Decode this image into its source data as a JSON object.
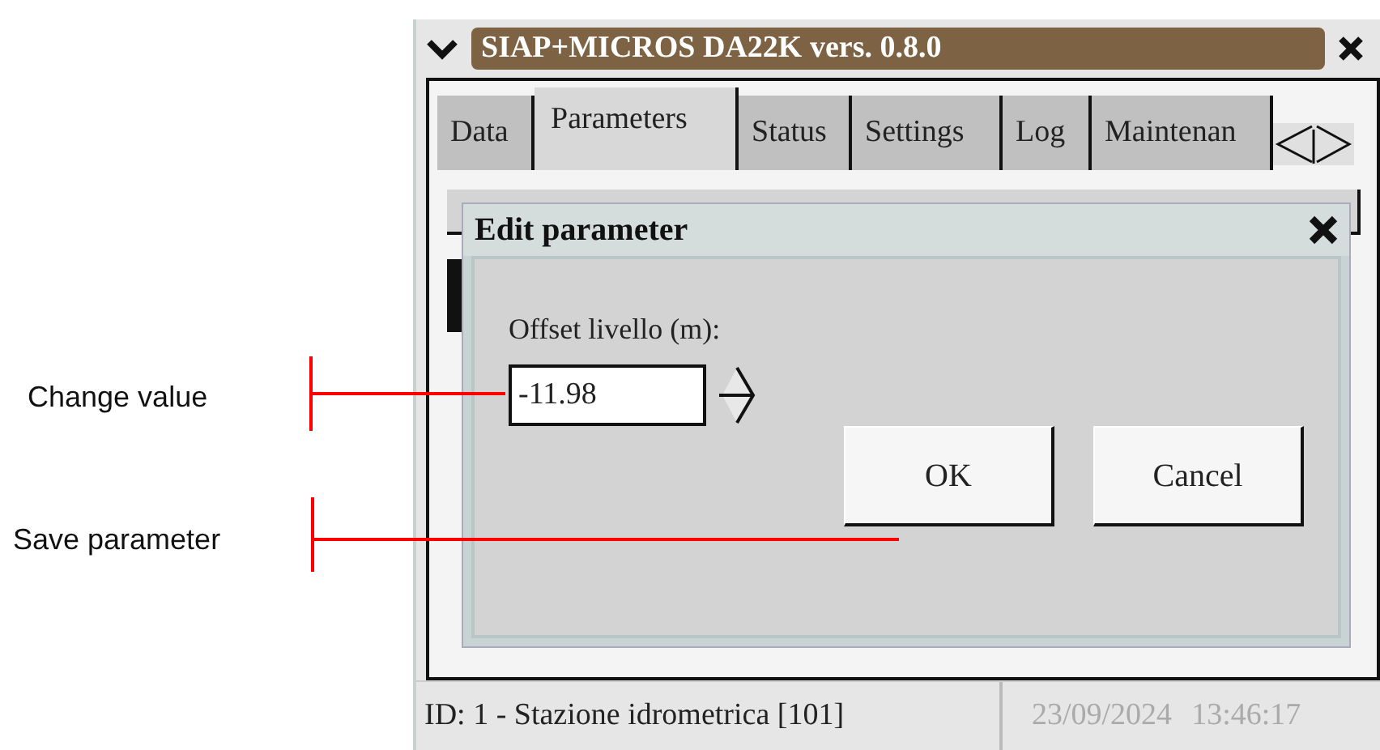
{
  "annotations": [
    {
      "text": "Change value"
    },
    {
      "text": "Save parameter"
    }
  ],
  "window": {
    "title": "SIAP+MICROS DA22K vers. 0.8.0"
  },
  "tabs": [
    {
      "label": "Data",
      "selected": false
    },
    {
      "label": "Parameters",
      "selected": true
    },
    {
      "label": "Status",
      "selected": false
    },
    {
      "label": "Settings",
      "selected": false
    },
    {
      "label": "Log",
      "selected": false
    },
    {
      "label": "Maintenan",
      "selected": false
    }
  ],
  "dialog": {
    "title": "Edit parameter",
    "field_label": "Offset livello (m):",
    "value": "-11.98",
    "buttons": [
      "OK",
      "Cancel"
    ]
  },
  "status_bar": {
    "station": "ID: 1 - Stazione idrometrica [101]",
    "date": "23/09/2024",
    "time": "13:46:17"
  }
}
